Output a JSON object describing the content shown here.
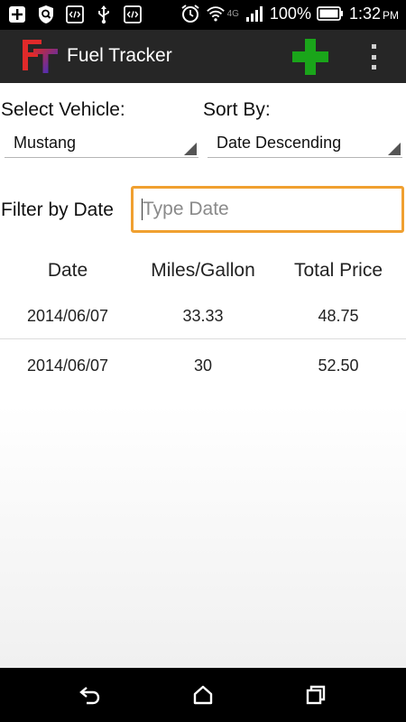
{
  "status_bar": {
    "battery_percent": "100%",
    "time": "1:32",
    "ampm": "PM",
    "network_label": "4G",
    "icons": [
      "add-box-icon",
      "shield-search-icon",
      "code-icon",
      "usb-icon",
      "code-icon",
      "alarm-icon",
      "wifi-icon",
      "signal-icon",
      "battery-icon"
    ]
  },
  "action_bar": {
    "title": "Fuel Tracker",
    "logo_text": "FT",
    "add_icon_color": "#1aa51a",
    "logo_colors": [
      "#e02a2a",
      "#3030e0"
    ]
  },
  "filters": {
    "vehicle_label": "Select Vehicle:",
    "vehicle_value": "Mustang",
    "sort_label": "Sort By:",
    "sort_value": "Date Descending",
    "date_label": "Filter by Date",
    "date_placeholder": "Type Date",
    "date_value": ""
  },
  "table": {
    "headers": [
      "Date",
      "Miles/Gallon",
      "Total Price"
    ],
    "rows": [
      [
        "2014/06/07",
        "33.33",
        "48.75"
      ],
      [
        "2014/06/07",
        "30",
        "52.50"
      ]
    ]
  },
  "nav_bar": {
    "icons": [
      "back-icon",
      "home-icon",
      "recents-icon"
    ]
  },
  "colors": {
    "accent": "#f0a030",
    "action_bar": "#262626",
    "status_bar": "#000000"
  }
}
